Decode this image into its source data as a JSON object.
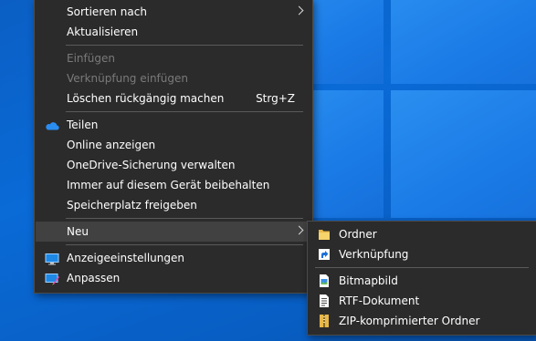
{
  "context_menu": {
    "sort_by": "Sortieren nach",
    "refresh": "Aktualisieren",
    "paste": "Einfügen",
    "paste_shortcut": "Verknüpfung einfügen",
    "undo_delete": "Löschen rückgängig machen",
    "undo_delete_shortcut": "Strg+Z",
    "share": "Teilen",
    "view_online": "Online anzeigen",
    "manage_backup": "OneDrive-Sicherung verwalten",
    "always_keep": "Immer auf diesem Gerät beibehalten",
    "free_space": "Speicherplatz freigeben",
    "new": "Neu",
    "display_settings": "Anzeigeeinstellungen",
    "personalize": "Anpassen"
  },
  "new_submenu": {
    "folder": "Ordner",
    "shortcut": "Verknüpfung",
    "bitmap": "Bitmapbild",
    "rtf": "RTF-Dokument",
    "zip": "ZIP-komprimierter Ordner"
  },
  "colors": {
    "menu_bg": "#2b2b2b",
    "highlight": "#414141",
    "desktop_blue": "#0a6ad6"
  },
  "icons": [
    "chevron-right-icon",
    "onedrive-cloud-icon",
    "display-icon",
    "paintbrush-icon",
    "folder-icon",
    "shortcut-icon",
    "bitmap-icon",
    "rtf-document-icon",
    "zip-folder-icon"
  ]
}
